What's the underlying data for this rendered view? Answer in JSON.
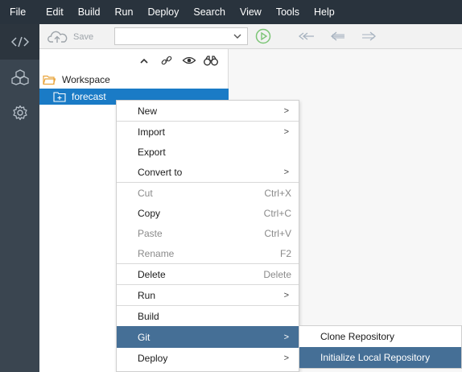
{
  "menubar": {
    "items": [
      "File",
      "Edit",
      "Build",
      "Run",
      "Deploy",
      "Search",
      "View",
      "Tools",
      "Help"
    ]
  },
  "activitybar": {
    "icons": [
      "code-icon",
      "cubes-icon",
      "gear-icon"
    ]
  },
  "toolbar": {
    "save_label": "Save",
    "run_config_value": "",
    "icons": [
      "cloud-upload-icon",
      "chevron-down-icon",
      "run-icon",
      "back-to-edit-icon",
      "arrow-left-icon",
      "arrow-right-icon"
    ]
  },
  "explorer": {
    "tool_icons": [
      "collapse-icon",
      "link-icon",
      "eye-icon",
      "binoculars-icon"
    ],
    "workspace_label": "Workspace",
    "project_label": "forecast"
  },
  "context_menu": {
    "items": [
      {
        "label": "New",
        "shortcut": "",
        "submenu": true,
        "disabled": false
      },
      {
        "label": "Import",
        "shortcut": "",
        "submenu": true,
        "disabled": false
      },
      {
        "label": "Export",
        "shortcut": "",
        "submenu": false,
        "disabled": false
      },
      {
        "label": "Convert to",
        "shortcut": "",
        "submenu": true,
        "disabled": false
      },
      {
        "label": "Cut",
        "shortcut": "Ctrl+X",
        "submenu": false,
        "disabled": true
      },
      {
        "label": "Copy",
        "shortcut": "Ctrl+C",
        "submenu": false,
        "disabled": false
      },
      {
        "label": "Paste",
        "shortcut": "Ctrl+V",
        "submenu": false,
        "disabled": true
      },
      {
        "label": "Rename",
        "shortcut": "F2",
        "submenu": false,
        "disabled": true
      },
      {
        "label": "Delete",
        "shortcut": "Delete",
        "submenu": false,
        "disabled": false
      },
      {
        "label": "Run",
        "shortcut": "",
        "submenu": true,
        "disabled": false
      },
      {
        "label": "Build",
        "shortcut": "",
        "submenu": false,
        "disabled": false
      },
      {
        "label": "Git",
        "shortcut": "",
        "submenu": true,
        "disabled": false,
        "highlighted": true
      },
      {
        "label": "Deploy",
        "shortcut": "",
        "submenu": true,
        "disabled": false
      }
    ],
    "arrow_glyph": ">"
  },
  "git_submenu": {
    "items": [
      {
        "label": "Clone Repository",
        "highlighted": false
      },
      {
        "label": "Initialize Local Repository",
        "highlighted": true
      }
    ]
  },
  "colors": {
    "menubar_bg": "#29333d",
    "activity_bg": "#3a4550",
    "selection_blue": "#1a7bc6",
    "menu_highlight": "#456f96",
    "run_green": "#7cc576"
  }
}
